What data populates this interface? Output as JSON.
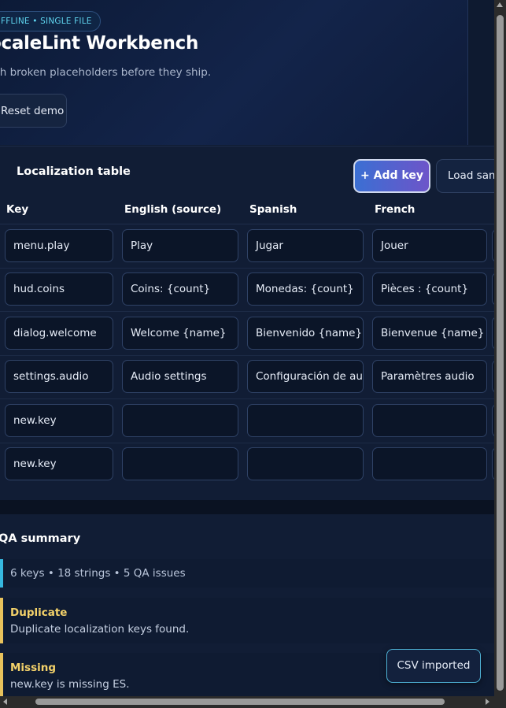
{
  "header": {
    "badge": "FFLINE • SINGLE FILE",
    "title": "ocaleLint Workbench",
    "subtitle": "tch broken placeholders before they ship.",
    "reset_label": "Reset demo"
  },
  "table": {
    "title": "Localization table",
    "add_label": "+ Add key",
    "load_label": "Load sam",
    "columns": [
      "Key",
      "English (source)",
      "Spanish",
      "French"
    ],
    "rows": [
      [
        "menu.play",
        "Play",
        "Jugar",
        "Jouer"
      ],
      [
        "hud.coins",
        "Coins: {count}",
        "Monedas: {count}",
        "Pièces : {count}"
      ],
      [
        "dialog.welcome",
        "Welcome {name}",
        "Bienvenido {name}",
        "Bienvenue {name}"
      ],
      [
        "settings.audio",
        "Audio settings",
        "Configuración de au",
        "Paramètres audio"
      ],
      [
        "new.key",
        "",
        "",
        ""
      ],
      [
        "new.key",
        "",
        "",
        ""
      ]
    ]
  },
  "qa": {
    "title": "QA summary",
    "stats": "6 keys • 18 strings • 5 QA issues",
    "issues": [
      {
        "type": "Duplicate",
        "message": "Duplicate localization keys found."
      },
      {
        "type": "Missing",
        "message": "new.key is missing ES."
      }
    ]
  },
  "toast": "CSV imported",
  "colors": {
    "accent": "#5fd4ee",
    "warning": "#e8c25c",
    "button_gradient_start": "#3b6fd3",
    "button_gradient_end": "#6d55c9",
    "background": "#0e1a30"
  }
}
